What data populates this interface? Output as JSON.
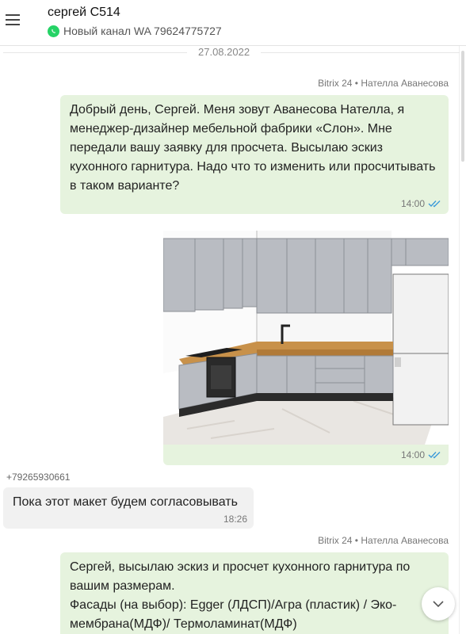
{
  "header": {
    "title": "сергей С514",
    "channel": "Новый канал WA 79624775727"
  },
  "date_separator": "27.08.2022",
  "messages": [
    {
      "sender": "Bitrix 24 • Нателла Аванесова",
      "text": "Добрый день, Сергей. Меня зовут Аванесова Нателла, я менеджер-дизайнер мебельной фабрики «Слон». Мне передали вашу заявку для просчета. Высылаю эскиз кухонного гарнитура. Надо что то изменить или просчитывать в таком варианте?",
      "time": "14:00"
    },
    {
      "time": "14:00"
    },
    {
      "phone": "+79265930661",
      "text": "Пока этот макет будем согласовывать",
      "time": "18:26"
    },
    {
      "sender": "Bitrix 24 • Нателла Аванесова",
      "text": "Сергей, высылаю эскиз и просчет кухонного гарнитура по вашим размерам.\nФасады (на выбор): Egger (ЛДСП)/Агра (пластик) / Эко-мембрана(МДФ)/ Термоламинат(МДФ)"
    }
  ],
  "colors": {
    "outgoing_bubble": "#e6f3de",
    "incoming_bubble": "#f1f1f1",
    "read_ticks": "#3b9ad9",
    "whatsapp": "#25d366"
  },
  "icons": {
    "menu": "hamburger-icon",
    "channel": "whatsapp-icon",
    "read": "double-check-icon",
    "scroll": "chevron-down-icon"
  }
}
